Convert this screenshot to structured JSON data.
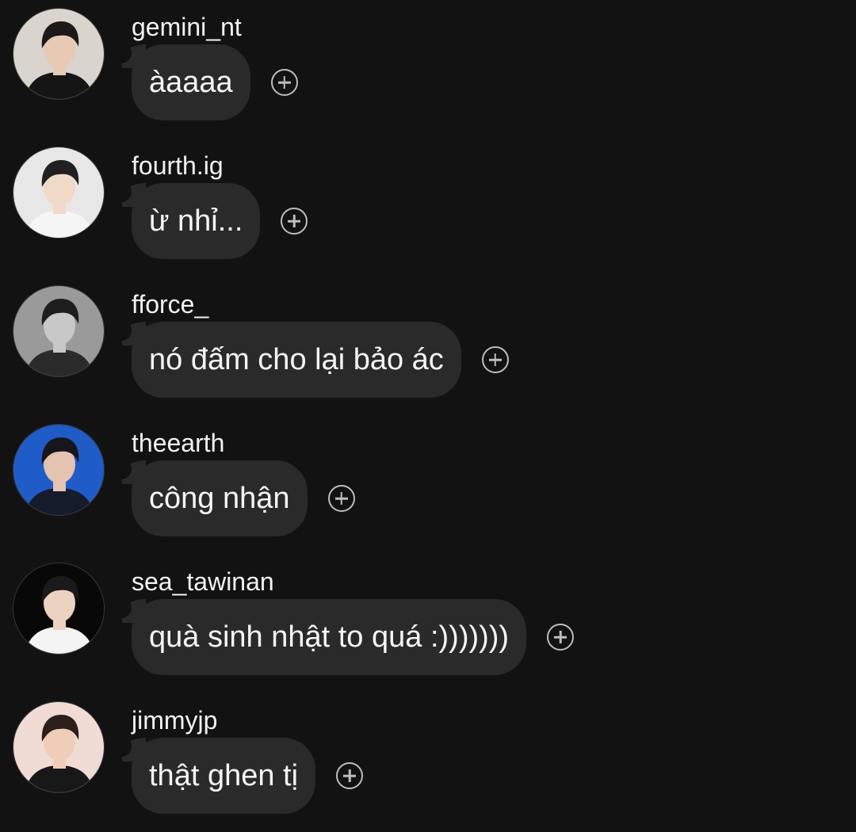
{
  "messages": [
    {
      "username": "gemini_nt",
      "text": "àaaaa",
      "avatar_icon": "person-portrait-icon",
      "avatar_colors": {
        "bg": "#d9d4cd",
        "hair": "#1c1a19",
        "skin": "#e8c9b3",
        "shirt": "#151515"
      }
    },
    {
      "username": "fourth.ig",
      "text": "ừ nhỉ...",
      "avatar_icon": "person-portrait-icon",
      "avatar_colors": {
        "bg": "#e7e7e7",
        "hair": "#202020",
        "skin": "#f1d9c8",
        "shirt": "#f5f5f5"
      }
    },
    {
      "username": "fforce_",
      "text": "nó đấm cho lại bảo ác",
      "avatar_icon": "person-portrait-icon",
      "avatar_colors": {
        "bg": "#9a9a9a",
        "hair": "#1e1e1e",
        "skin": "#c8c8c8",
        "shirt": "#2a2a2a"
      }
    },
    {
      "username": "theearth",
      "text": "công nhận",
      "avatar_icon": "person-portrait-icon",
      "avatar_colors": {
        "bg": "#1f5cc8",
        "hair": "#16161c",
        "skin": "#e4c3b0",
        "shirt": "#161b2c"
      }
    },
    {
      "username": "sea_tawinan",
      "text": "quà sinh nhật to quá :)))))))",
      "avatar_icon": "person-portrait-icon",
      "avatar_colors": {
        "bg": "#080808",
        "hair": "#1a1a1a",
        "skin": "#ecd2c0",
        "shirt": "#f3f3f3"
      }
    },
    {
      "username": "jimmyjp",
      "text": "thật ghen tị",
      "avatar_icon": "person-portrait-icon",
      "avatar_colors": {
        "bg": "#f1dcd5",
        "hair": "#2a1f1a",
        "skin": "#efcdb7",
        "shirt": "#181818"
      }
    }
  ],
  "react_icon": "add-reaction-icon",
  "colors": {
    "background": "#121212",
    "bubble": "#2a2a2a",
    "text": "#f5f5f5",
    "icon": "#bdbdbd"
  }
}
